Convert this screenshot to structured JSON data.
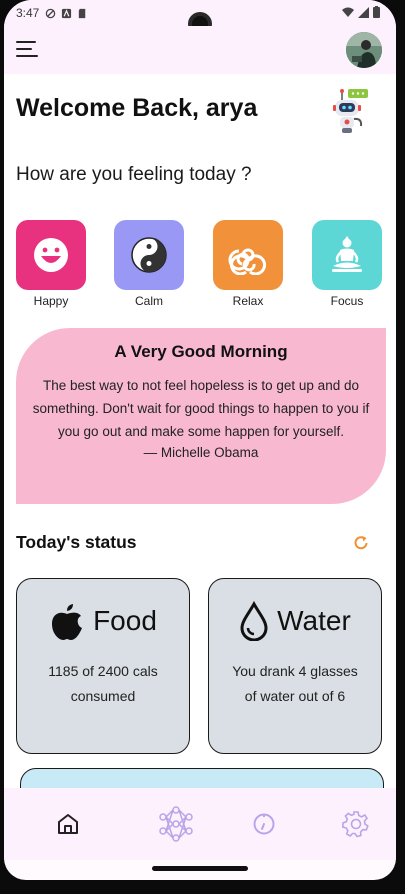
{
  "status_bar": {
    "time": "3:47"
  },
  "header": {
    "menu_icon": "hamburger-menu-icon",
    "avatar_icon": "user-avatar"
  },
  "greeting": "Welcome Back, arya",
  "feeling_prompt": "How are you feeling today ?",
  "moods": [
    {
      "label": "Happy",
      "color": "#e8317f",
      "icon": "smiley-icon"
    },
    {
      "label": "Calm",
      "color": "#9999f5",
      "icon": "yin-yang-icon"
    },
    {
      "label": "Relax",
      "color": "#f1913a",
      "icon": "triskelion-icon"
    },
    {
      "label": "Focus",
      "color": "#5dd6d6",
      "icon": "meditation-icon"
    }
  ],
  "quote": {
    "title": "A Very Good Morning",
    "text": "The best way to not feel hopeless is to get up and do something. Don't wait for good things to happen to you if you go out and make some happen for yourself.",
    "author": "— Michelle Obama",
    "color": "#f8b9d0"
  },
  "todays_status": {
    "title": "Today's status",
    "food": {
      "heading": "Food",
      "line1": "1185 of 2400 cals",
      "line2": "consumed"
    },
    "water": {
      "heading": "Water",
      "line1": "You drank 4 glasses",
      "line2": "of water out of 6"
    }
  },
  "bottom_nav": [
    "home-icon",
    "neural-network-icon",
    "timer-icon",
    "settings-icon"
  ],
  "colors": {
    "accent": "#b9a4e8",
    "refresh": "#f0902e",
    "nav_bg": "#fcf1fc"
  }
}
